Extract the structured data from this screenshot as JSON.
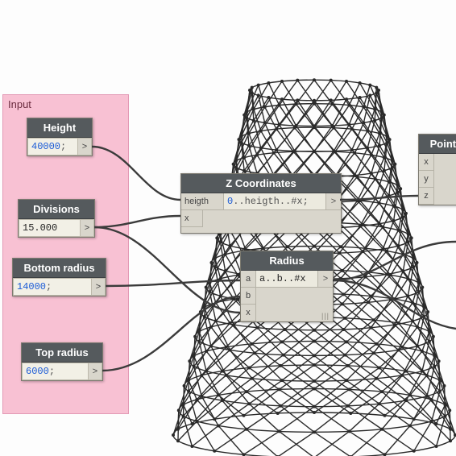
{
  "group": {
    "title": "Input"
  },
  "nodes": {
    "height": {
      "title": "Height",
      "value": "40000",
      "suffix": ";",
      "out": ">"
    },
    "divisions": {
      "title": "Divisions",
      "display": "15.000",
      "out": ">"
    },
    "bottomR": {
      "title": "Bottom radius",
      "value": "14000",
      "suffix": ";",
      "out": ">"
    },
    "topR": {
      "title": "Top radius",
      "value": "6000",
      "suffix": ";",
      "out": ">"
    },
    "zcoord": {
      "title": "Z Coordinates",
      "in1": "heigth",
      "in2": "x",
      "expr_a": "0",
      "expr_b": "..heigth..#x;",
      "out": ">"
    },
    "radius": {
      "title": "Radius",
      "inA": "a",
      "inB": "b",
      "inX": "x",
      "expr": "a..b..#x",
      "out": ">"
    },
    "point": {
      "title": "Point.By",
      "px": "x",
      "py": "y",
      "pz": "z"
    }
  }
}
